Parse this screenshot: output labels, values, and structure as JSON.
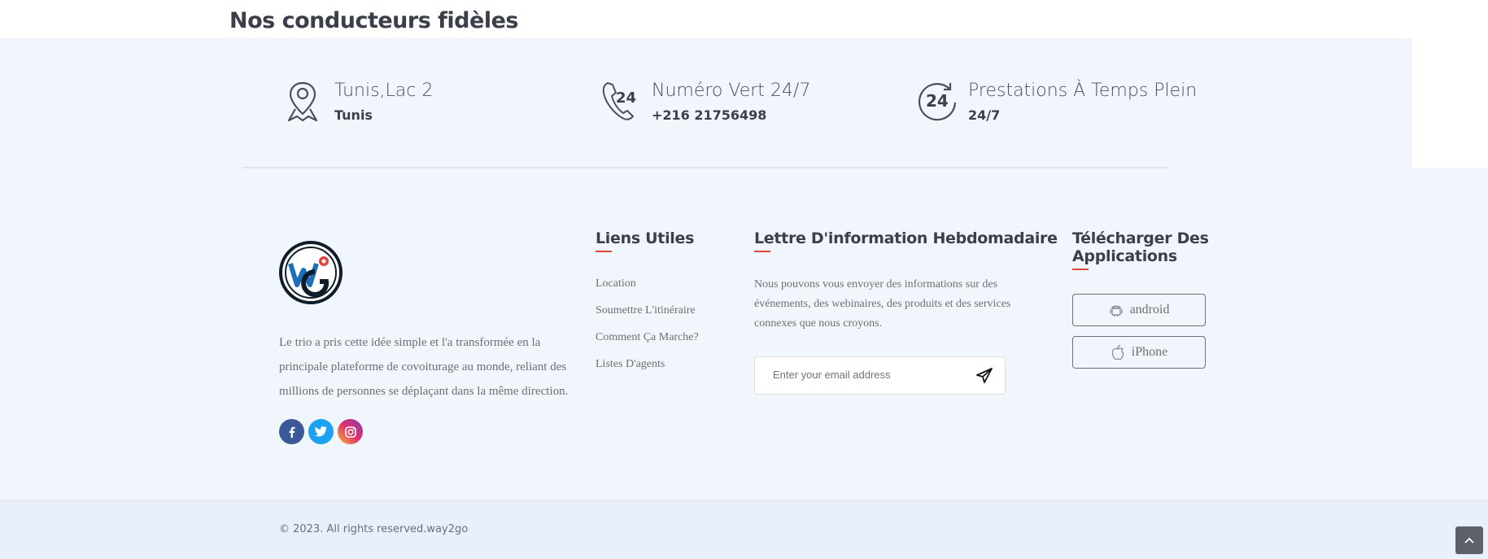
{
  "section": {
    "title": "Nos conducteurs fidèles"
  },
  "contact": [
    {
      "icon": "map-pin-icon",
      "title": "Tunis,Lac 2",
      "sub": "Tunis"
    },
    {
      "icon": "phone-24-icon",
      "title": "Numéro Vert 24/7",
      "sub": "+216 21756498"
    },
    {
      "icon": "clock-24-icon",
      "title": "Prestations À Temps Plein",
      "sub": "24/7"
    }
  ],
  "footer": {
    "logo": "way2go-logo",
    "about": "Le trio a pris cette idée simple et l'a transformée en la principale plateforme de covoiturage au monde, reliant des millions de personnes se déplaçant dans la même direction.",
    "social": [
      {
        "icon": "facebook-icon",
        "glyph": "f",
        "color": "#3b5998"
      },
      {
        "icon": "twitter-icon",
        "glyph": "t",
        "color": "#1da1f2"
      },
      {
        "icon": "instagram-icon",
        "glyph": "◎",
        "color": "#d6249f"
      }
    ],
    "links_title": "Liens Utiles",
    "links": [
      "Location",
      "Soumettre L'itinéraire",
      "Comment Ça Marche?",
      "Listes D'agents"
    ],
    "newsletter_title": "Lettre D'information Hebdomadaire",
    "newsletter_text": "Nous pouvons vous envoyer des informations sur des événements, des webinaires, des produits et des services connexes que nous croyons.",
    "email_placeholder": "Enter your email address",
    "apps_title": "Télécharger Des Applications",
    "apps": [
      {
        "icon": "android-icon",
        "label": "android"
      },
      {
        "icon": "apple-icon",
        "label": "iPhone"
      }
    ]
  },
  "bottom": {
    "copyright": "© 2023. All rights reserved.way2go"
  },
  "colors": {
    "accent": "#e0463c",
    "band": "#f1f6fc",
    "bottom": "#e9f0fb"
  }
}
